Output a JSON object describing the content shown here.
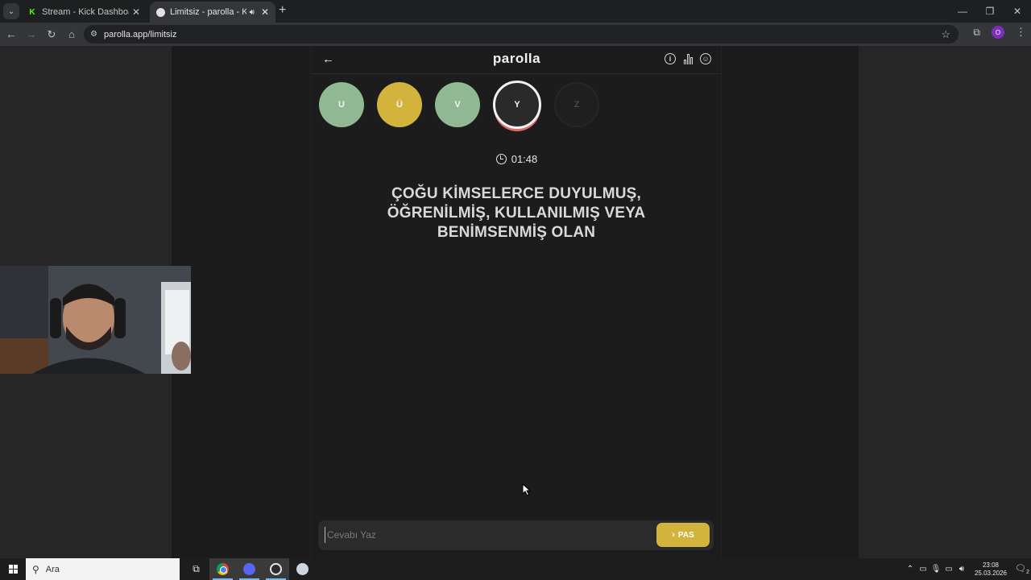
{
  "browser": {
    "tabs": [
      {
        "title": "Stream - Kick Dashboard",
        "favicon": "kick-icon"
      },
      {
        "title": "Limitsiz - parolla - Kelime o",
        "favicon": "parolla-icon"
      }
    ],
    "url": "parolla.app/limitsiz",
    "profile_initial": "O"
  },
  "app": {
    "brand": "parolla",
    "letters": [
      {
        "char": "U",
        "state": "correct",
        "color": "#8fb893"
      },
      {
        "char": "Ü",
        "state": "passed",
        "color": "#d2b33c"
      },
      {
        "char": "V",
        "state": "correct",
        "color": "#8fb893"
      },
      {
        "char": "Y",
        "state": "active"
      },
      {
        "char": "Z",
        "state": "pending"
      }
    ],
    "timer": "01:48",
    "question": "ÇOĞU KİMSELERCE DUYULMUŞ, ÖĞRENİLMİŞ, KULLANILMIŞ VEYA BENİMSENMİŞ OLAN",
    "answer_placeholder": "Cevabı Yaz",
    "pass_label": "PAS",
    "colors": {
      "accent_gold": "#d2b33c",
      "correct_green": "#8fb893",
      "active_ring": "#e06a6a"
    }
  },
  "taskbar": {
    "search_label": "Ara",
    "time": "23:08",
    "date": "25.03.2026",
    "notification_count": "2"
  }
}
